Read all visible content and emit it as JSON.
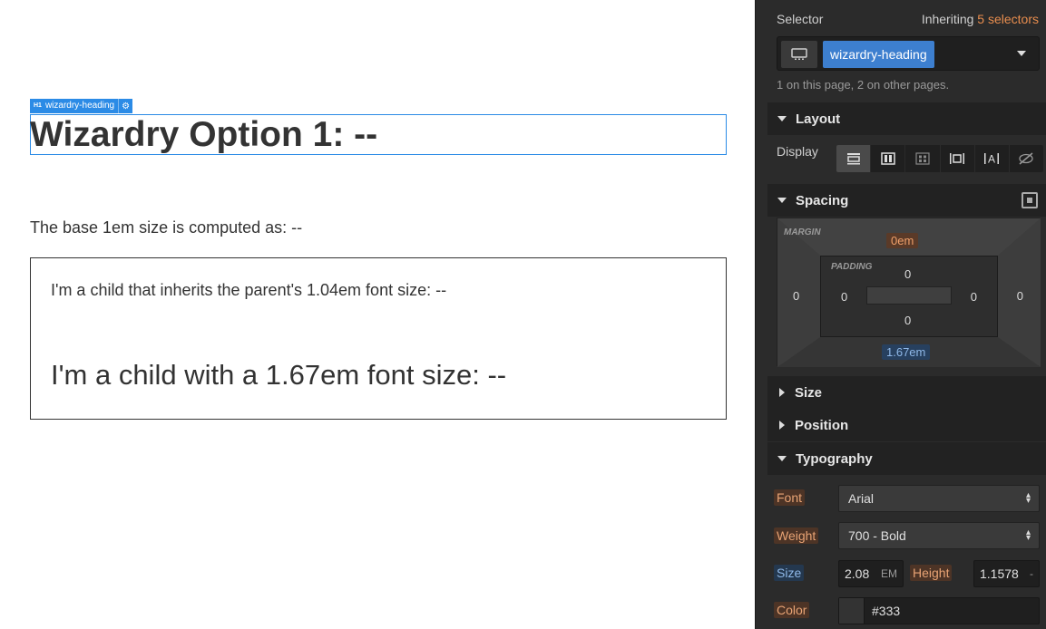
{
  "canvas": {
    "badge_tag": "H1",
    "badge_label": "wizardry-heading",
    "heading": "Wizardry Option 1: --",
    "base_text": "The base 1em size is computed as: --",
    "child1": "I'm a child that inherits the parent's 1.04em font size: --",
    "child2": "I'm a child with a 1.67em font size: --"
  },
  "panel": {
    "selector_label": "Selector",
    "inheriting_prefix": "Inheriting",
    "inheriting_count": "5 selectors",
    "selector_chip": "wizardry-heading",
    "count_note": "1 on this page, 2 on other pages.",
    "sections": {
      "layout": "Layout",
      "spacing": "Spacing",
      "size": "Size",
      "position": "Position",
      "typography": "Typography"
    },
    "display_label": "Display",
    "display_options": [
      "block",
      "flex",
      "grid",
      "inline-block",
      "inline",
      "none"
    ],
    "display_glyphs": [
      "▭",
      "▥",
      "⊞",
      "|▢|",
      "|A|",
      "⊘"
    ],
    "spacing": {
      "margin_label": "MARGIN",
      "padding_label": "PADDING",
      "margin_top": "0em",
      "margin_right": "0",
      "margin_bottom": "1.67em",
      "margin_left": "0",
      "padding_top": "0",
      "padding_right": "0",
      "padding_bottom": "0",
      "padding_left": "0"
    },
    "typography": {
      "font_label": "Font",
      "font_value": "Arial",
      "weight_label": "Weight",
      "weight_value": "700 - Bold",
      "size_label": "Size",
      "size_value": "2.08",
      "size_unit": "EM",
      "height_label": "Height",
      "height_value": "1.1578",
      "height_unit": "-",
      "color_label": "Color",
      "color_value": "#333"
    }
  },
  "colors": {
    "accent_blue": "#2b8be6",
    "inherit_orange": "#e88d4e",
    "panel_bg": "#2b2b2b",
    "text_dark": "#333333"
  }
}
